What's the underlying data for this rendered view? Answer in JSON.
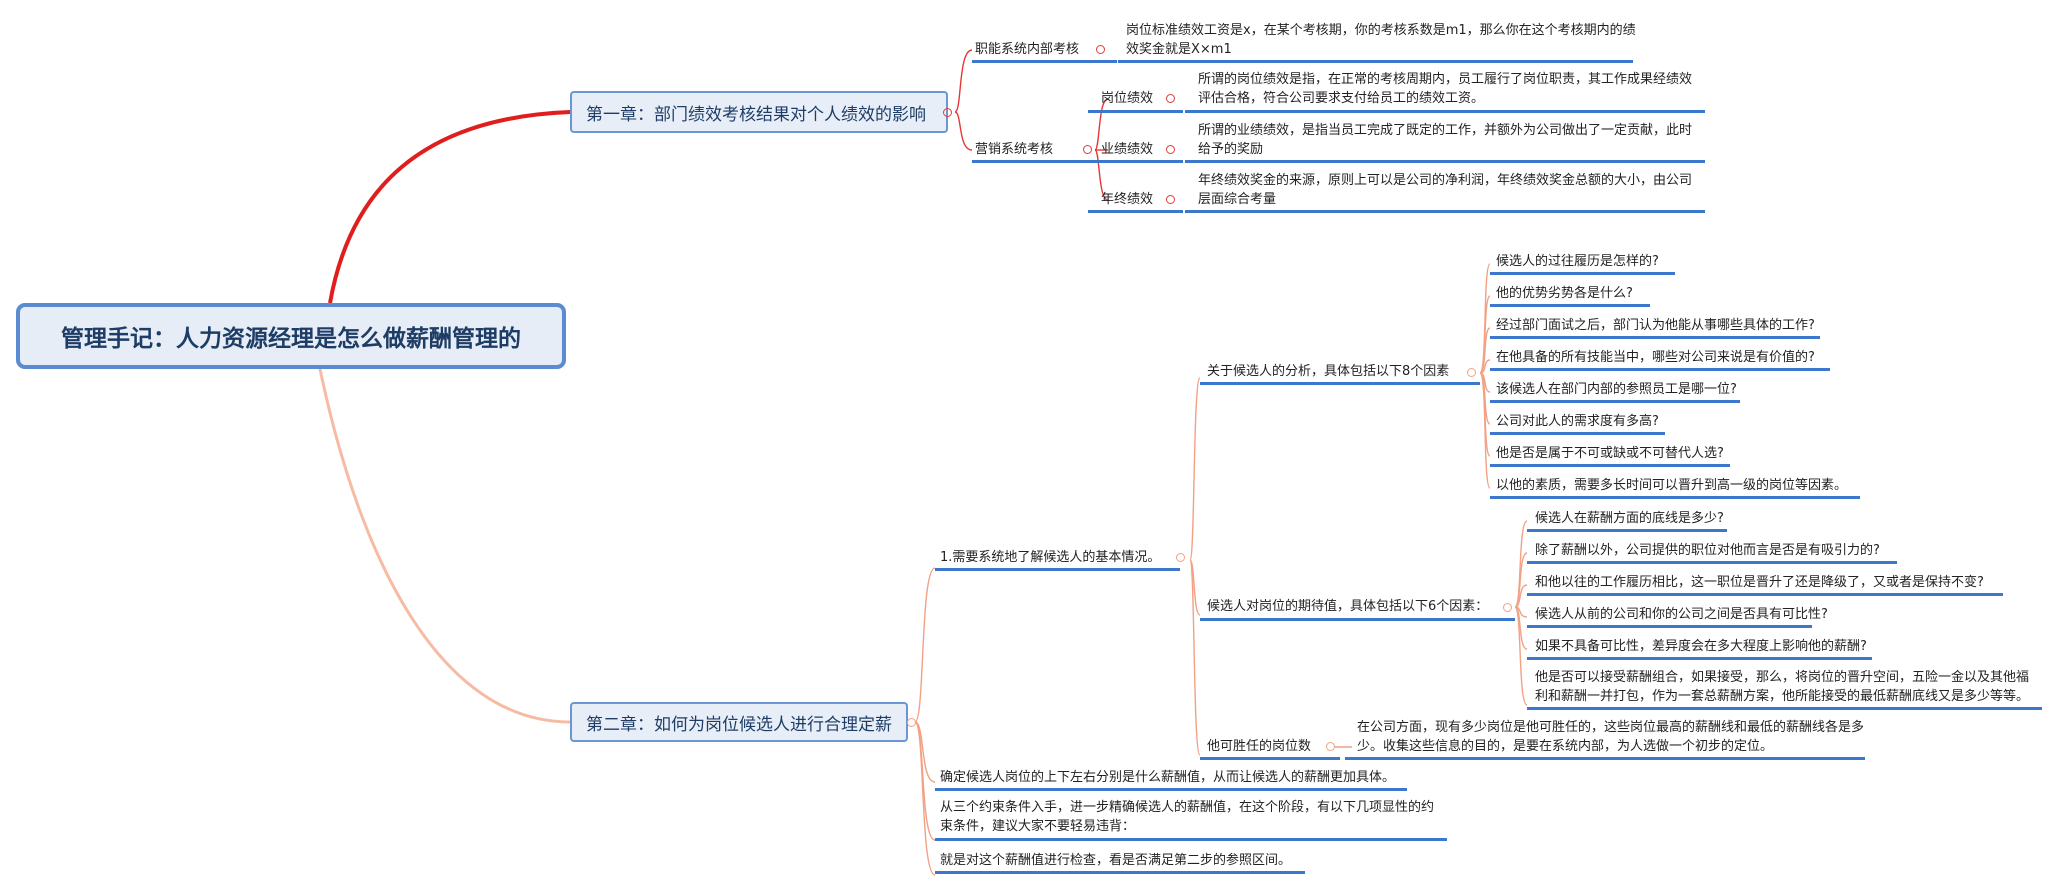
{
  "root": {
    "title": "管理手记：人力资源经理是怎么做薪酬管理的"
  },
  "chapter1": {
    "title": "第一章：部门绩效考核结果对个人绩效的影响",
    "func": {
      "label": "职能系统内部考核",
      "text": "岗位标准绩效工资是x，在某个考核期，你的考核系数是m1，那么你在这个考核期内的绩效奖金就是X×m1"
    },
    "sales": {
      "label": "营销系统考核",
      "items": [
        {
          "label": "岗位绩效",
          "text": "所谓的岗位绩效是指，在正常的考核周期内，员工履行了岗位职责，其工作成果经绩效评估合格，符合公司要求支付给员工的绩效工资。"
        },
        {
          "label": "业绩绩效",
          "text": "所谓的业绩绩效，是指当员工完成了既定的工作，并额外为公司做出了一定贡献，此时给予的奖励"
        },
        {
          "label": "年终绩效",
          "text": "年终绩效奖金的来源，原则上可以是公司的净利润，年终绩效奖金总额的大小，由公司层面综合考量"
        }
      ]
    }
  },
  "chapter2": {
    "title": "第二章：如何为岗位候选人进行合理定薪",
    "step1": {
      "label": "1.需要系统地了解候选人的基本情况。",
      "analysis": {
        "label": "关于候选人的分析，具体包括以下8个因素",
        "items": [
          "候选人的过往履历是怎样的?",
          "他的优势劣势各是什么?",
          "经过部门面试之后，部门认为他能从事哪些具体的工作?",
          "在他具备的所有技能当中，哪些对公司来说是有价值的?",
          "该候选人在部门内部的参照员工是哪一位?",
          "公司对此人的需求度有多高?",
          "他是否是属于不可或缺或不可替代人选?",
          "以他的素质，需要多长时间可以晋升到高一级的岗位等因素。"
        ]
      },
      "expect": {
        "label": "候选人对岗位的期待值，具体包括以下6个因素：",
        "items": [
          "候选人在薪酬方面的底线是多少?",
          "除了薪酬以外，公司提供的职位对他而言是否是有吸引力的?",
          "和他以往的工作履历相比，这一职位是晋升了还是降级了，又或者是保持不变?",
          "候选人从前的公司和你的公司之间是否具有可比性?",
          "如果不具备可比性，差异度会在多大程度上影响他的薪酬?",
          "他是否可以接受薪酬组合，如果接受，那么，将岗位的晋升空间，五险一金以及其他福利和薪酬一并打包，作为一套总薪酬方案，他所能接受的最低薪酬底线又是多少等等。"
        ]
      },
      "positions": {
        "label": "他可胜任的岗位数",
        "text": "在公司方面，现有多少岗位是他可胜任的，这些岗位最高的薪酬线和最低的薪酬线各是多少。收集这些信息的目的，是要在系统内部，为人选做一个初步的定位。"
      }
    },
    "step2": "确定候选人岗位的上下左右分别是什么薪酬值，从而让候选人的薪酬更加具体。",
    "step3": "从三个约束条件入手，进一步精确候选人的薪酬值，在这个阶段，有以下几项显性的约束条件，建议大家不要轻易违背：",
    "step4": "就是对这个薪酬值进行检查，看是否满足第二步的参照区间。"
  },
  "colors": {
    "branch1": "#e53935",
    "branch2": "#f2a184",
    "underline": "#3b78cc",
    "box_border": "#6a96d2"
  }
}
